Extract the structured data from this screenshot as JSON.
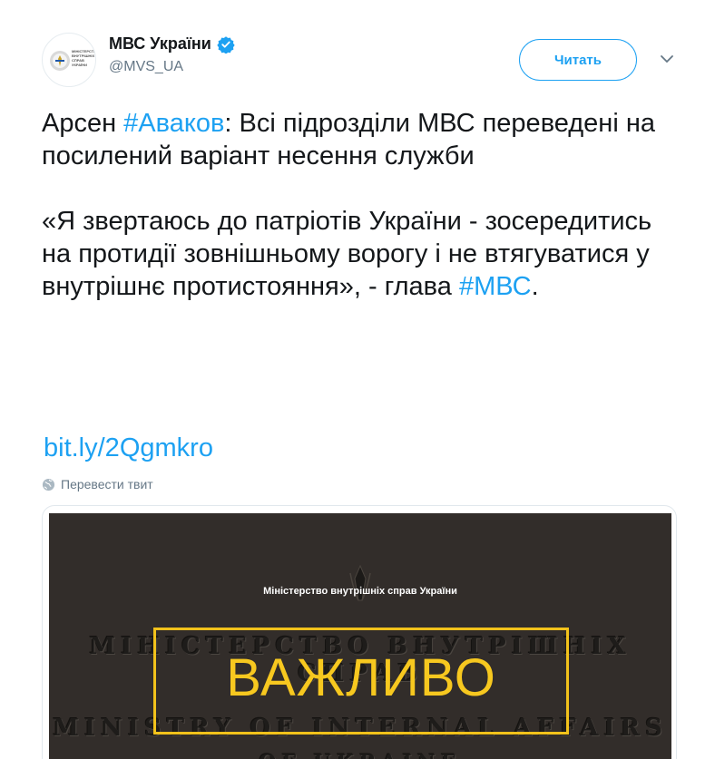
{
  "account": {
    "display_name": "МВС України",
    "handle": "@MVS_UA",
    "avatar_text": "МІНІСТЕРСТВО ВНУТРІШНІХ СПРАВ УКРАЇНИ"
  },
  "follow_button": {
    "label": "Читать"
  },
  "tweet": {
    "p1_a": "Арсен ",
    "p1_hashtag": "#Аваков",
    "p1_b": ": Всі підрозділи МВС переведені на посилений варіант несення служби",
    "p2_a": "«Я звертаюсь до патріотів України - зосередитись на протидії зовнішньому ворогу і не втягуватися у внутрішнє протистояння», - глава ",
    "p2_hashtag": "#МВС",
    "p2_b": ".",
    "link": "bit.ly/2Qgmkro"
  },
  "translate": {
    "label": "Перевести твит"
  },
  "card": {
    "caption": "Міністерство внутрішніх справ України",
    "plaque_line1": "МІНІСТЕРСТВО ВНУТРІШНІХ СПРАВ",
    "plaque_line2": "MINISTRY OF INTERNAL AFFAIRS",
    "plaque_line3": "OF UKRAINE",
    "headline": "ВАЖЛИВО"
  },
  "colors": {
    "accent": "#1da1f2",
    "text": "#14171a",
    "secondary": "#657786",
    "headline_yellow": "#f7c81f"
  },
  "icons": [
    "verified-badge-icon",
    "chevron-down-icon",
    "globe-icon",
    "trident-icon"
  ]
}
